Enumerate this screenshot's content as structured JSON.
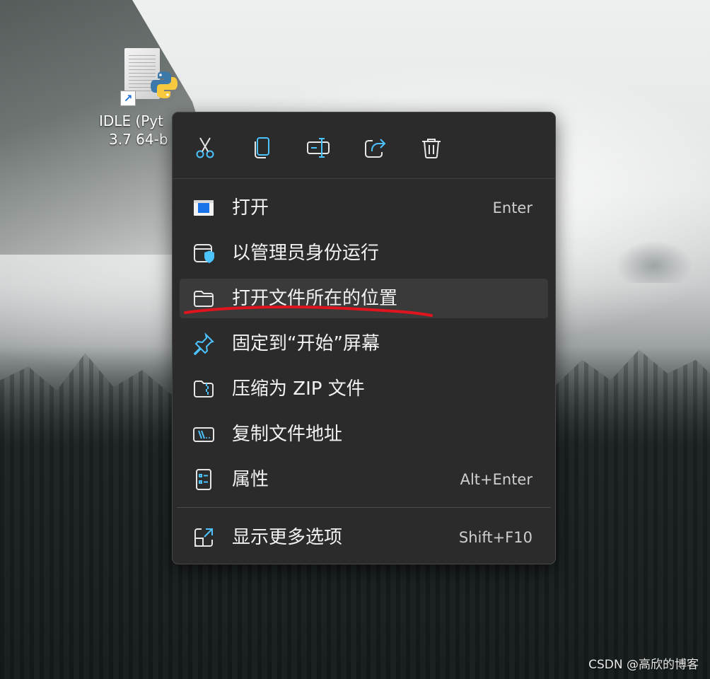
{
  "desktop": {
    "icon_label_line1": "IDLE (Pyt",
    "icon_label_line2": "3.7 64-b",
    "icon_name": "python-idle-shortcut-icon",
    "watermark": "CSDN @高欣的博客"
  },
  "context_menu": {
    "toolbar": [
      {
        "name": "cut-icon"
      },
      {
        "name": "copy-icon"
      },
      {
        "name": "rename-icon"
      },
      {
        "name": "share-icon"
      },
      {
        "name": "delete-icon"
      }
    ],
    "items": [
      {
        "label": "打开",
        "shortcut": "Enter",
        "icon": "open-app-icon"
      },
      {
        "label": "以管理员身份运行",
        "shortcut": "",
        "icon": "shield-window-icon"
      },
      {
        "label": "打开文件所在的位置",
        "shortcut": "",
        "icon": "folder-icon",
        "highlighted": true
      },
      {
        "label": "固定到“开始”屏幕",
        "shortcut": "",
        "icon": "pin-icon"
      },
      {
        "label": "压缩为 ZIP 文件",
        "shortcut": "",
        "icon": "zip-folder-icon"
      },
      {
        "label": "复制文件地址",
        "shortcut": "",
        "icon": "copy-path-icon"
      },
      {
        "label": "属性",
        "shortcut": "Alt+Enter",
        "icon": "properties-icon"
      }
    ],
    "more": {
      "label": "显示更多选项",
      "shortcut": "Shift+F10",
      "icon": "open-external-icon"
    }
  },
  "colors": {
    "accent": "#4cc2ff",
    "menu_bg": "#2b2b2b",
    "annotation_red": "#e0141e"
  }
}
